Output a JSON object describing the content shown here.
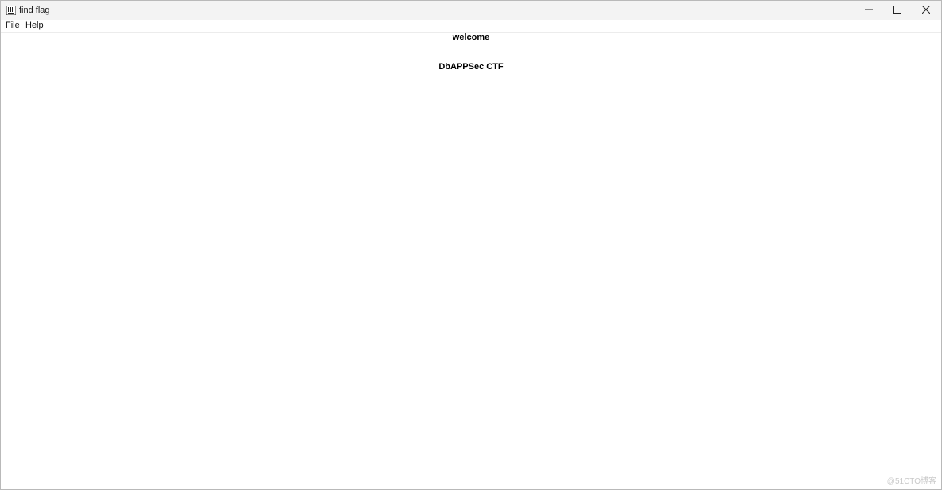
{
  "window": {
    "title": "find flag",
    "icon": "barcode-app-icon"
  },
  "controls": {
    "minimize": "minimize-icon",
    "maximize": "maximize-icon",
    "close": "close-icon"
  },
  "menu": {
    "items": [
      {
        "label": "File"
      },
      {
        "label": "Help"
      }
    ]
  },
  "content": {
    "welcome": "welcome",
    "ctf": "DbAPPSec CTF"
  },
  "watermark": "@51CTO博客"
}
